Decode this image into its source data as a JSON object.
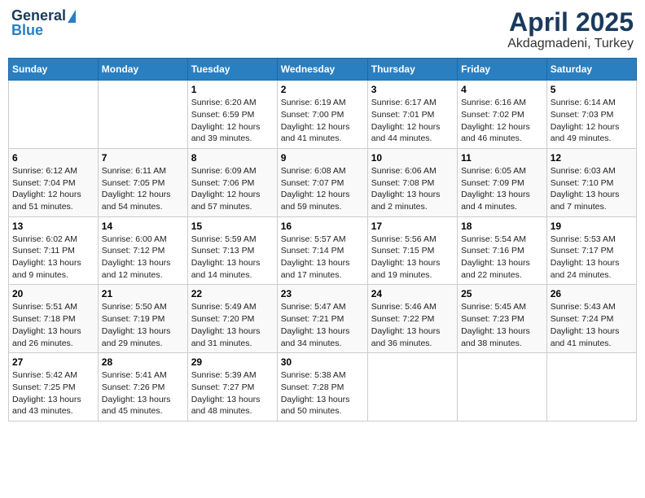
{
  "logo": {
    "line1": "General",
    "line2": "Blue"
  },
  "title": "April 2025",
  "subtitle": "Akdagmadeni, Turkey",
  "weekdays": [
    "Sunday",
    "Monday",
    "Tuesday",
    "Wednesday",
    "Thursday",
    "Friday",
    "Saturday"
  ],
  "weeks": [
    [
      {
        "day": "",
        "info": ""
      },
      {
        "day": "",
        "info": ""
      },
      {
        "day": "1",
        "info": "Sunrise: 6:20 AM\nSunset: 6:59 PM\nDaylight: 12 hours and 39 minutes."
      },
      {
        "day": "2",
        "info": "Sunrise: 6:19 AM\nSunset: 7:00 PM\nDaylight: 12 hours and 41 minutes."
      },
      {
        "day": "3",
        "info": "Sunrise: 6:17 AM\nSunset: 7:01 PM\nDaylight: 12 hours and 44 minutes."
      },
      {
        "day": "4",
        "info": "Sunrise: 6:16 AM\nSunset: 7:02 PM\nDaylight: 12 hours and 46 minutes."
      },
      {
        "day": "5",
        "info": "Sunrise: 6:14 AM\nSunset: 7:03 PM\nDaylight: 12 hours and 49 minutes."
      }
    ],
    [
      {
        "day": "6",
        "info": "Sunrise: 6:12 AM\nSunset: 7:04 PM\nDaylight: 12 hours and 51 minutes."
      },
      {
        "day": "7",
        "info": "Sunrise: 6:11 AM\nSunset: 7:05 PM\nDaylight: 12 hours and 54 minutes."
      },
      {
        "day": "8",
        "info": "Sunrise: 6:09 AM\nSunset: 7:06 PM\nDaylight: 12 hours and 57 minutes."
      },
      {
        "day": "9",
        "info": "Sunrise: 6:08 AM\nSunset: 7:07 PM\nDaylight: 12 hours and 59 minutes."
      },
      {
        "day": "10",
        "info": "Sunrise: 6:06 AM\nSunset: 7:08 PM\nDaylight: 13 hours and 2 minutes."
      },
      {
        "day": "11",
        "info": "Sunrise: 6:05 AM\nSunset: 7:09 PM\nDaylight: 13 hours and 4 minutes."
      },
      {
        "day": "12",
        "info": "Sunrise: 6:03 AM\nSunset: 7:10 PM\nDaylight: 13 hours and 7 minutes."
      }
    ],
    [
      {
        "day": "13",
        "info": "Sunrise: 6:02 AM\nSunset: 7:11 PM\nDaylight: 13 hours and 9 minutes."
      },
      {
        "day": "14",
        "info": "Sunrise: 6:00 AM\nSunset: 7:12 PM\nDaylight: 13 hours and 12 minutes."
      },
      {
        "day": "15",
        "info": "Sunrise: 5:59 AM\nSunset: 7:13 PM\nDaylight: 13 hours and 14 minutes."
      },
      {
        "day": "16",
        "info": "Sunrise: 5:57 AM\nSunset: 7:14 PM\nDaylight: 13 hours and 17 minutes."
      },
      {
        "day": "17",
        "info": "Sunrise: 5:56 AM\nSunset: 7:15 PM\nDaylight: 13 hours and 19 minutes."
      },
      {
        "day": "18",
        "info": "Sunrise: 5:54 AM\nSunset: 7:16 PM\nDaylight: 13 hours and 22 minutes."
      },
      {
        "day": "19",
        "info": "Sunrise: 5:53 AM\nSunset: 7:17 PM\nDaylight: 13 hours and 24 minutes."
      }
    ],
    [
      {
        "day": "20",
        "info": "Sunrise: 5:51 AM\nSunset: 7:18 PM\nDaylight: 13 hours and 26 minutes."
      },
      {
        "day": "21",
        "info": "Sunrise: 5:50 AM\nSunset: 7:19 PM\nDaylight: 13 hours and 29 minutes."
      },
      {
        "day": "22",
        "info": "Sunrise: 5:49 AM\nSunset: 7:20 PM\nDaylight: 13 hours and 31 minutes."
      },
      {
        "day": "23",
        "info": "Sunrise: 5:47 AM\nSunset: 7:21 PM\nDaylight: 13 hours and 34 minutes."
      },
      {
        "day": "24",
        "info": "Sunrise: 5:46 AM\nSunset: 7:22 PM\nDaylight: 13 hours and 36 minutes."
      },
      {
        "day": "25",
        "info": "Sunrise: 5:45 AM\nSunset: 7:23 PM\nDaylight: 13 hours and 38 minutes."
      },
      {
        "day": "26",
        "info": "Sunrise: 5:43 AM\nSunset: 7:24 PM\nDaylight: 13 hours and 41 minutes."
      }
    ],
    [
      {
        "day": "27",
        "info": "Sunrise: 5:42 AM\nSunset: 7:25 PM\nDaylight: 13 hours and 43 minutes."
      },
      {
        "day": "28",
        "info": "Sunrise: 5:41 AM\nSunset: 7:26 PM\nDaylight: 13 hours and 45 minutes."
      },
      {
        "day": "29",
        "info": "Sunrise: 5:39 AM\nSunset: 7:27 PM\nDaylight: 13 hours and 48 minutes."
      },
      {
        "day": "30",
        "info": "Sunrise: 5:38 AM\nSunset: 7:28 PM\nDaylight: 13 hours and 50 minutes."
      },
      {
        "day": "",
        "info": ""
      },
      {
        "day": "",
        "info": ""
      },
      {
        "day": "",
        "info": ""
      }
    ]
  ]
}
